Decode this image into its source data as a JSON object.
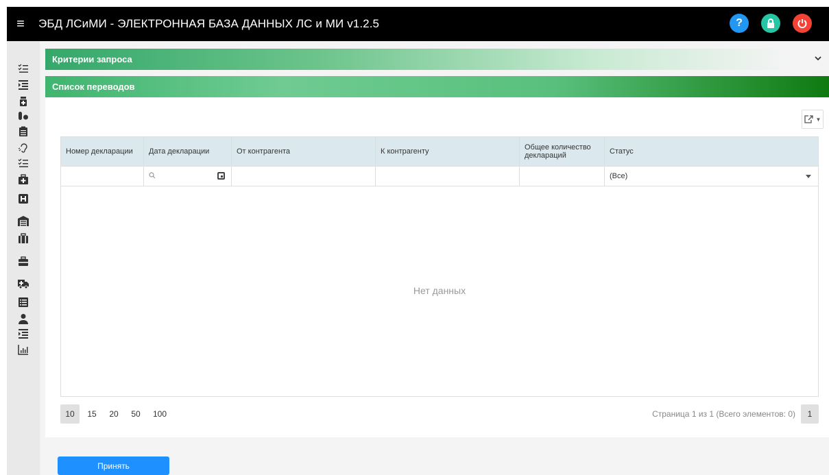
{
  "header": {
    "menu_icon": "hamburger-icon",
    "title": "ЭБД ЛСиМИ - ЭЛЕКТРОННАЯ БАЗА ДАННЫХ ЛС и МИ v1.2.5",
    "help_label": "?",
    "colors": {
      "help": "#2196f3",
      "lock": "#26c6a4",
      "power": "#f44336"
    }
  },
  "sidebar": {
    "icons": [
      "list-check-icon",
      "indent-list-icon",
      "medicine-bottle-icon",
      "pills-icon",
      "clipboard-icon",
      "hearing-icon",
      "list-check-icon",
      "medical-bag-icon",
      "hospital-icon",
      "warehouse-icon",
      "suitcase-icon",
      "toolbox-icon",
      "ambulance-icon",
      "table-list-icon",
      "user-icon",
      "indent-list-icon",
      "chart-icon"
    ]
  },
  "criteria": {
    "title": "Критерии запроса"
  },
  "transfers": {
    "title": "Список переводов",
    "export_icon": "export-icon",
    "columns": [
      "Номер декларации",
      "Дата декларации",
      "От контрагента",
      "К контрагенту",
      "Общее количество деклараций",
      "Статус"
    ],
    "status_filter": "(Все)",
    "empty_text": "Нет данных",
    "page_sizes": [
      "10",
      "15",
      "20",
      "50",
      "100"
    ],
    "active_page_size": "10",
    "page_info": "Страница 1 из 1 (Всего элементов: 0)",
    "current_page": "1"
  },
  "actions": {
    "accept_label": "Принять",
    "accept_color": "#1e90ff"
  }
}
